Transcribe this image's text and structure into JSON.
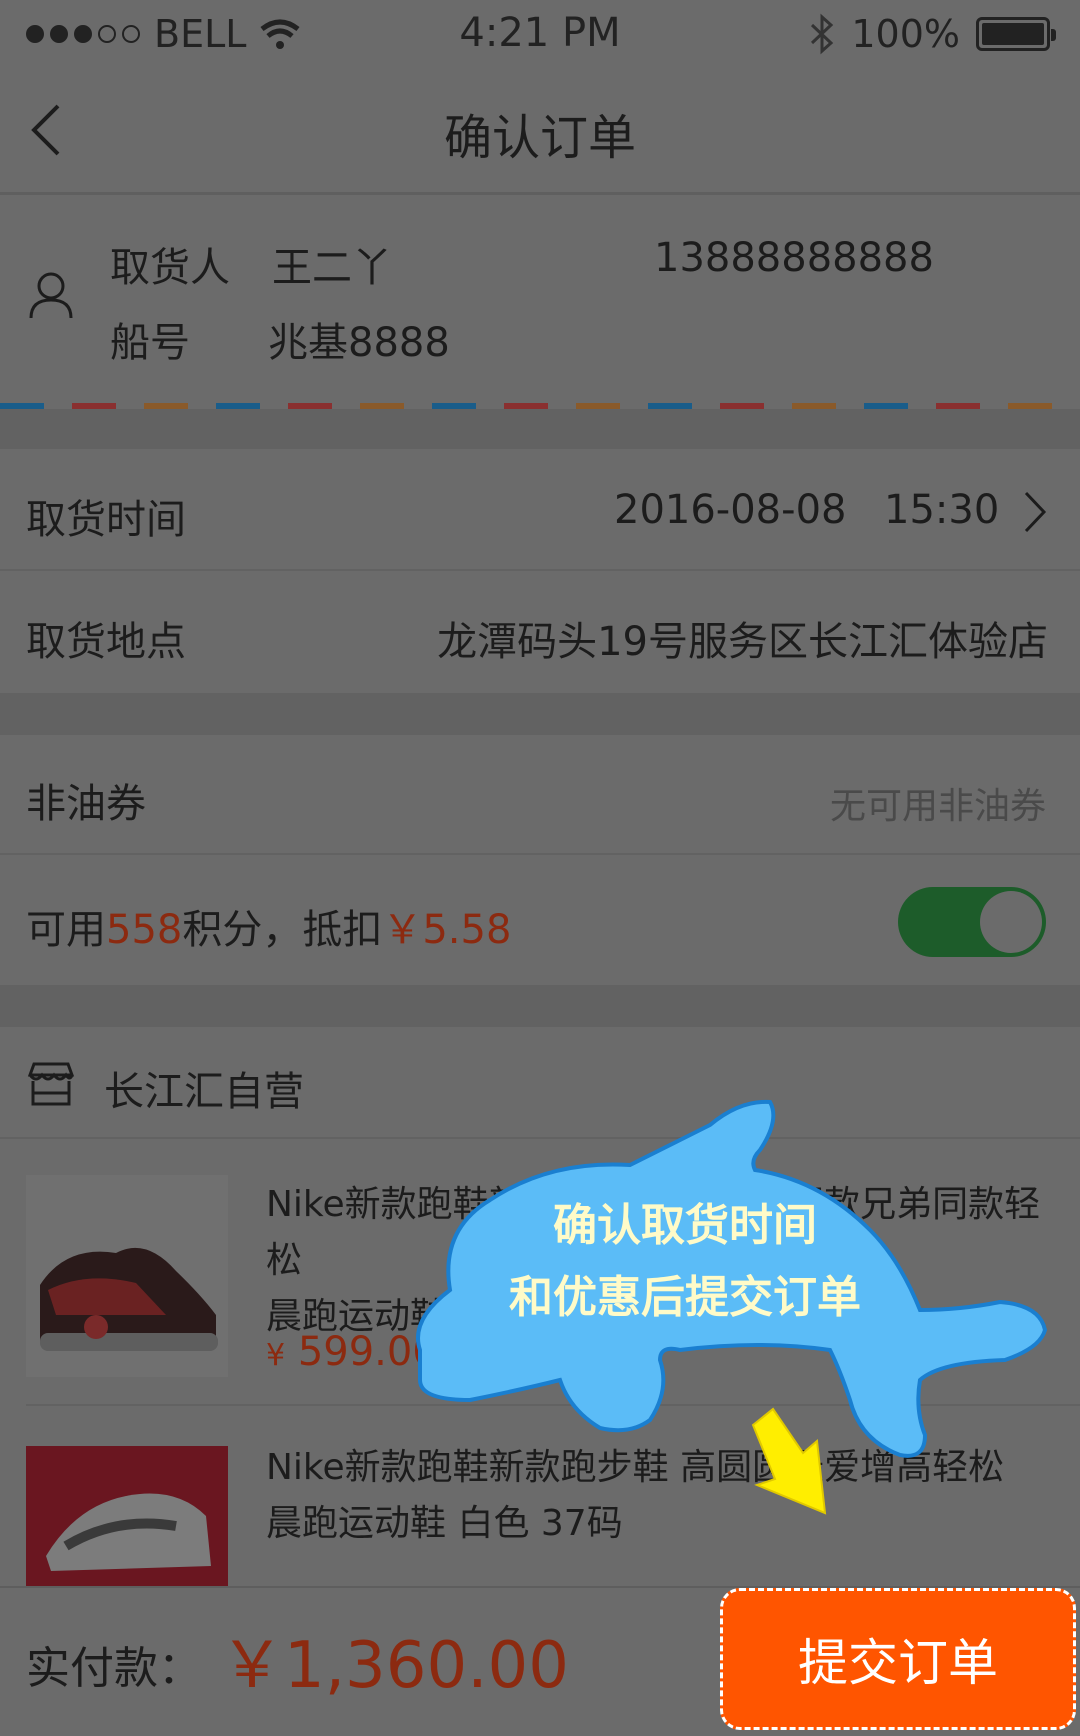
{
  "status_bar": {
    "carrier": "BELL",
    "time": "4:21 PM",
    "battery": "100%"
  },
  "nav": {
    "title": "确认订单"
  },
  "recipient": {
    "name_label": "取货人",
    "name": "王二丫",
    "phone": "13888888888",
    "boat_label": "船号",
    "boat": "兆基8888"
  },
  "pickup": {
    "time_label": "取货时间",
    "date": "2016-08-08",
    "time": "15:30",
    "place_label": "取货地点",
    "place": "龙潭码头19号服务区长江汇体验店"
  },
  "coupon": {
    "label": "非油券",
    "value": "无可用非油券"
  },
  "points": {
    "prefix": "可用",
    "count": "558",
    "middle": "积分，抵扣",
    "amount": "￥5.58",
    "enabled": true
  },
  "store": {
    "name": "长江汇自营"
  },
  "products": [
    {
      "name_line1": "Nike新款跑鞋新款跑步鞋 高圆圆同款兄弟同款轻松",
      "name_line2": "晨跑运动鞋",
      "price": "599.00",
      "currency": "¥"
    },
    {
      "name_line1": "Nike新款跑鞋新款跑步鞋  高圆圆最爱增高轻松",
      "name_line2": "晨跑运动鞋    白色   37码"
    }
  ],
  "bottom": {
    "total_label": "实付款：",
    "total": "￥1,360.00",
    "submit_label": "提交订单"
  },
  "tooltip": {
    "line1": "确认取货时间",
    "line2": "和优惠后提交订单"
  },
  "colors": {
    "accent": "#ff5500",
    "bubble": "#5bbcf7",
    "arrow": "#ffee00"
  }
}
